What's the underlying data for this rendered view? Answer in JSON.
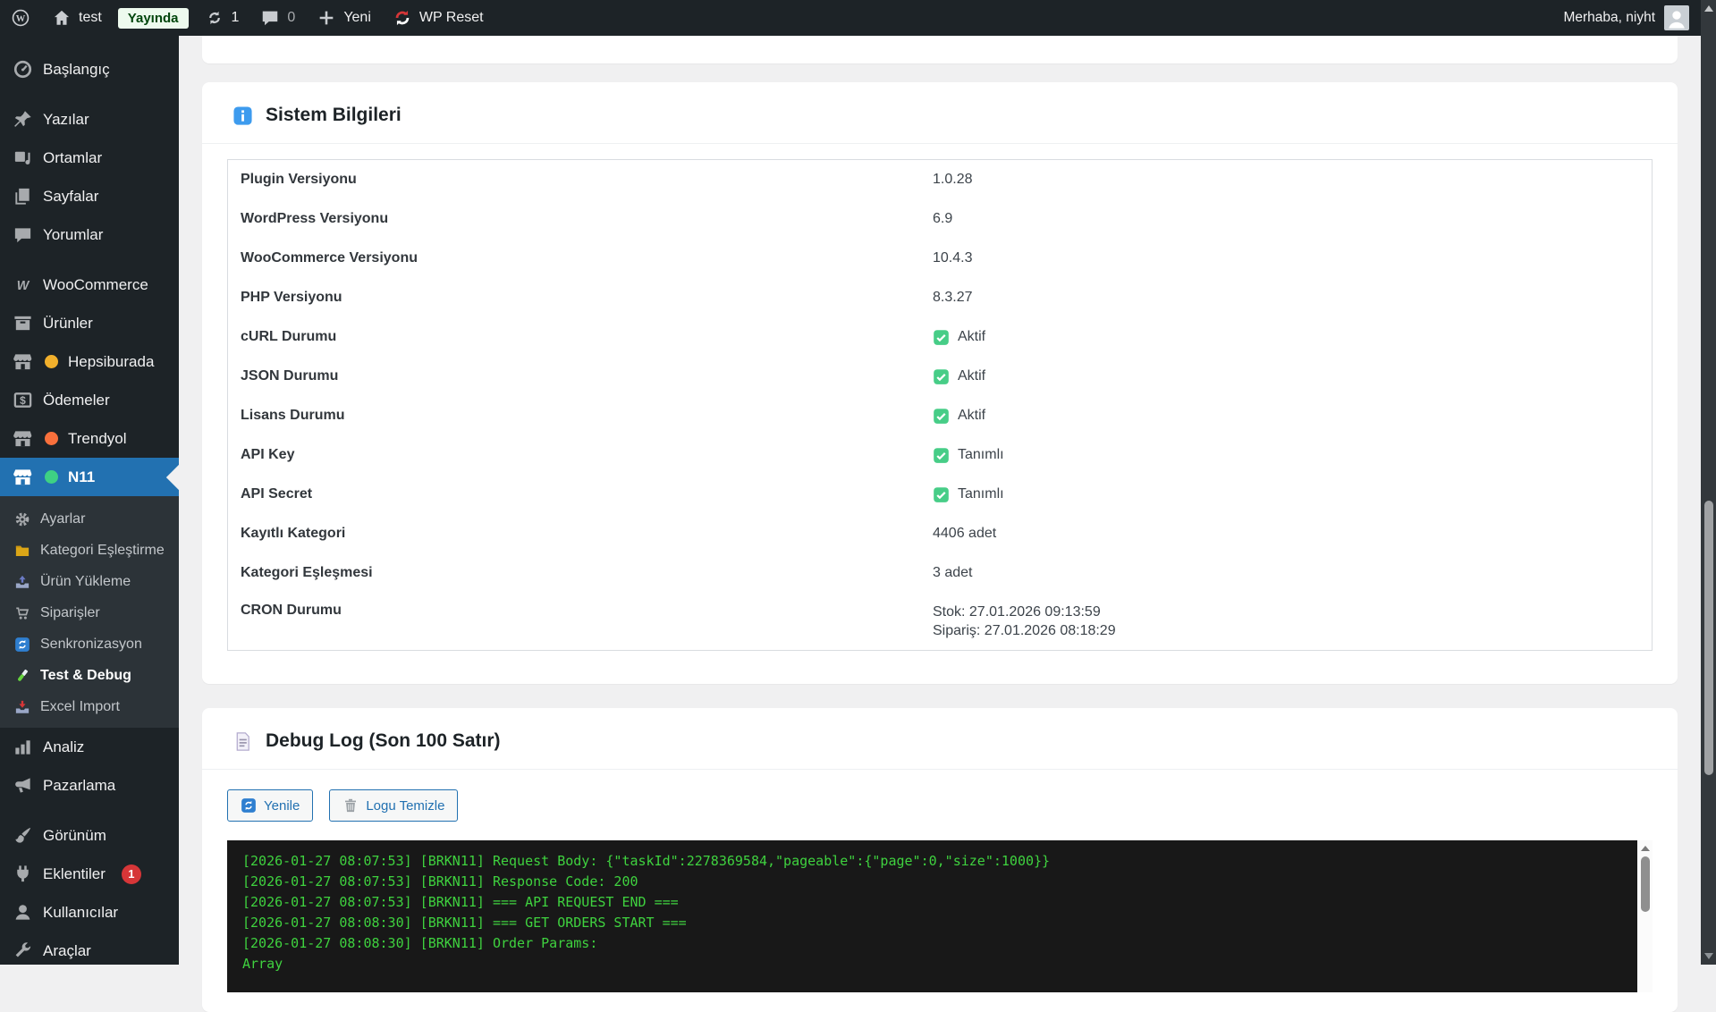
{
  "admin_bar": {
    "site_name": "test",
    "status_badge": "Yayında",
    "update_count": "1",
    "comment_count": "0",
    "new_label": "Yeni",
    "wp_reset_label": "WP Reset",
    "greeting": "Merhaba, niyht"
  },
  "sidebar": {
    "items_top": [
      {
        "id": "baslangic",
        "label": "Başlangıç",
        "icon": "dashboard-icon",
        "gap_before": false
      },
      {
        "id": "yazilar",
        "label": "Yazılar",
        "icon": "posts-icon",
        "gap_before": true
      },
      {
        "id": "ortamlar",
        "label": "Ortamlar",
        "icon": "media-icon"
      },
      {
        "id": "sayfalar",
        "label": "Sayfalar",
        "icon": "pages-icon"
      },
      {
        "id": "yorumlar",
        "label": "Yorumlar",
        "icon": "comments-icon"
      },
      {
        "id": "woocommerce",
        "label": "WooCommerce",
        "icon": "woocommerce-icon",
        "gap_before": true
      },
      {
        "id": "urunler",
        "label": "Ürünler",
        "icon": "products-icon"
      },
      {
        "id": "hepsiburada",
        "label": "Hepsiburada",
        "icon": "store-icon",
        "dot_color": "#f2b02c"
      },
      {
        "id": "odemeler",
        "label": "Ödemeler",
        "icon": "payments-icon"
      },
      {
        "id": "trendyol",
        "label": "Trendyol",
        "icon": "store-icon",
        "dot_color": "#f9703c"
      },
      {
        "id": "n11",
        "label": "N11",
        "icon": "store-icon",
        "dot_color": "#3ed184",
        "active": true
      }
    ],
    "submenu": [
      {
        "id": "ayarlar",
        "label": "Ayarlar",
        "icon": "gear-icon"
      },
      {
        "id": "kategori-eslestirme",
        "label": "Kategori Eşleştirme",
        "icon": "folder-icon"
      },
      {
        "id": "urun-yukleme",
        "label": "Ürün Yükleme",
        "icon": "upload-icon"
      },
      {
        "id": "siparisler",
        "label": "Siparişler",
        "icon": "orders-cart-icon"
      },
      {
        "id": "senkronizasyon",
        "label": "Senkronizasyon",
        "icon": "sync-icon"
      },
      {
        "id": "test-debug",
        "label": "Test & Debug",
        "icon": "test-tube-icon",
        "current": true
      },
      {
        "id": "excel-import",
        "label": "Excel Import",
        "icon": "excel-import-icon"
      }
    ],
    "items_bottom": [
      {
        "id": "analiz",
        "label": "Analiz",
        "icon": "analytics-icon"
      },
      {
        "id": "pazarlama",
        "label": "Pazarlama",
        "icon": "marketing-icon"
      },
      {
        "id": "gorunum",
        "label": "Görünüm",
        "icon": "appearance-icon",
        "gap_before": true
      },
      {
        "id": "eklentiler",
        "label": "Eklentiler",
        "icon": "plugins-icon",
        "badge": "1"
      },
      {
        "id": "kullanicilar",
        "label": "Kullanıcılar",
        "icon": "users-icon"
      },
      {
        "id": "araclar",
        "label": "Araçlar",
        "icon": "tools-icon"
      }
    ]
  },
  "system_info": {
    "title": "Sistem Bilgileri",
    "icon": "info-icon",
    "rows": [
      {
        "label": "Plugin Versiyonu",
        "value": "1.0.28"
      },
      {
        "label": "WordPress Versiyonu",
        "value": "6.9"
      },
      {
        "label": "WooCommerce Versiyonu",
        "value": "10.4.3"
      },
      {
        "label": "PHP Versiyonu",
        "value": "8.3.27"
      },
      {
        "label": "cURL Durumu",
        "value": "Aktif",
        "check": true
      },
      {
        "label": "JSON Durumu",
        "value": "Aktif",
        "check": true
      },
      {
        "label": "Lisans Durumu",
        "value": "Aktif",
        "check": true
      },
      {
        "label": "API Key",
        "value": "Tanımlı",
        "check": true
      },
      {
        "label": "API Secret",
        "value": "Tanımlı",
        "check": true
      },
      {
        "label": "Kayıtlı Kategori",
        "value": "4406 adet"
      },
      {
        "label": "Kategori Eşleşmesi",
        "value": "3 adet"
      },
      {
        "label": "CRON Durumu",
        "value_lines": [
          "Stok: 27.01.2026 09:13:59",
          "Sipariş: 27.01.2026 08:18:29"
        ]
      }
    ]
  },
  "debug_log": {
    "title": "Debug Log (Son 100 Satır)",
    "icon": "document-icon",
    "refresh_button": "Yenile",
    "clear_button": "Logu Temizle",
    "lines": [
      "[2026-01-27 08:07:53] [BRKN11] Request Body: {\"taskId\":2278369584,\"pageable\":{\"page\":0,\"size\":1000}}",
      "[2026-01-27 08:07:53] [BRKN11] Response Code: 200",
      "[2026-01-27 08:07:53] [BRKN11] === API REQUEST END ===",
      "[2026-01-27 08:08:30] [BRKN11] === GET ORDERS START ===",
      "[2026-01-27 08:08:30] [BRKN11] Order Params:",
      "Array"
    ]
  },
  "colors": {
    "accent_blue": "#2271b1",
    "sidebar_bg": "#1d2327",
    "submenu_bg": "#2c3338",
    "check_green": "#47cd87",
    "terminal_green": "#3fd23f",
    "terminal_bg": "#181818",
    "badge_red": "#d63638",
    "status_badge_bg": "#edfaee",
    "status_badge_text": "#00450c"
  }
}
